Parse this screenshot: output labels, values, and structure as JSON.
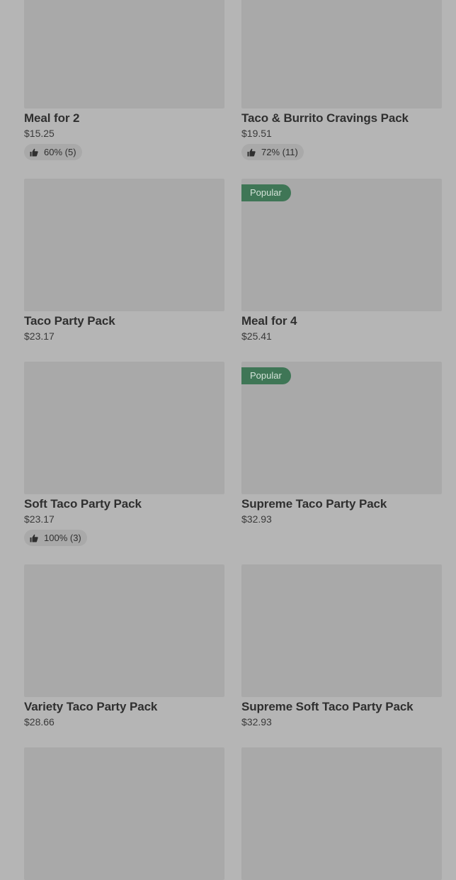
{
  "products": [
    {
      "name": "Meal for 2",
      "price": "$15.25",
      "badge": "",
      "rating": "60% (5)"
    },
    {
      "name": "Taco & Burrito Cravings Pack",
      "price": "$19.51",
      "badge": "",
      "rating": "72% (11)"
    },
    {
      "name": "Taco Party Pack",
      "price": "$23.17",
      "badge": "",
      "rating": ""
    },
    {
      "name": "Meal for 4",
      "price": "$25.41",
      "badge": "Popular",
      "rating": ""
    },
    {
      "name": "Soft Taco Party Pack",
      "price": "$23.17",
      "badge": "",
      "rating": "100% (3)"
    },
    {
      "name": "Supreme Taco Party Pack",
      "price": "$32.93",
      "badge": "Popular",
      "rating": ""
    },
    {
      "name": "Variety Taco Party Pack",
      "price": "$28.66",
      "badge": "",
      "rating": ""
    },
    {
      "name": "Supreme Soft Taco Party Pack",
      "price": "$32.93",
      "badge": "",
      "rating": ""
    },
    {
      "name": "",
      "price": "",
      "badge": "",
      "rating": ""
    },
    {
      "name": "",
      "price": "",
      "badge": "",
      "rating": ""
    }
  ],
  "rating_icon": "thumbs-up-icon",
  "colors": {
    "overlay_background": "#b5b5b5",
    "image_placeholder": "#a9a9a9",
    "popular_badge": "#3f7656"
  }
}
